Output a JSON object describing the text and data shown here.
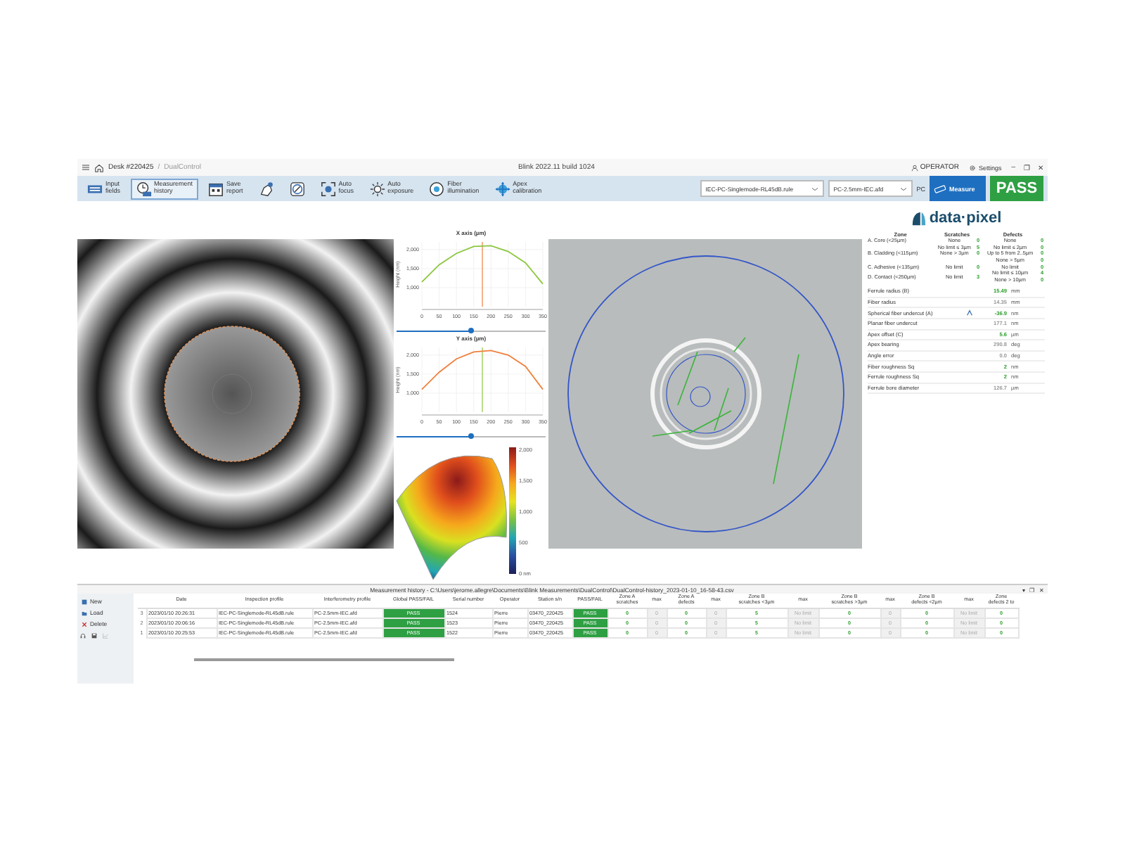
{
  "title_bar": {
    "breadcrumb": [
      "Desk #220425",
      "DualControl"
    ],
    "separator": "/",
    "app_title": "Blink 2022.11 build 1024",
    "user": "OPERATOR",
    "settings": "Settings",
    "window_controls": [
      "–",
      "❐",
      "✕"
    ]
  },
  "toolbar": {
    "buttons": [
      {
        "kind": "keyboard",
        "label": "Input\nfields",
        "selected": false
      },
      {
        "kind": "clock",
        "label": "Measurement\nhistory",
        "selected": true
      },
      {
        "kind": "calendar",
        "label": "Save\nreport",
        "selected": false
      },
      {
        "kind": "hand",
        "selected": false
      },
      {
        "kind": "compass",
        "selected": false
      },
      {
        "kind": "focus",
        "label": "Auto\nfocus",
        "selected": false
      },
      {
        "kind": "sun",
        "label": "Auto\nexposure",
        "selected": false
      },
      {
        "kind": "ring",
        "label": "Fiber\nillumination",
        "selected": false
      },
      {
        "kind": "crosshair",
        "label": "Apex\ncalibration",
        "selected": false
      }
    ],
    "profile_select": "IEC-PC-Singlemode-RL45dB.rule",
    "interferometry_select": "PC-2.5mm-IEC.afd",
    "connector_type": "PC",
    "measure_button": "Measure",
    "result": {
      "label": "PASS",
      "passed": true
    }
  },
  "profiles": [
    {
      "slider": {
        "level": 0.5
      },
      "chart_data": {
        "type": "line",
        "title": "X axis (µm)",
        "ylabel": "Height (nm)",
        "grid": true,
        "ref_lines": [
          {
            "axis": "x",
            "value": 175,
            "color": "#f07f3c"
          }
        ],
        "x": [
          0,
          50,
          100,
          150,
          200,
          250,
          300,
          350
        ],
        "series": [
          {
            "color": "#8cc63f",
            "values": [
              1150,
              1600,
              1900,
              2080,
              2100,
              1950,
              1650,
              1100
            ]
          }
        ],
        "xlim": [
          0,
          350
        ],
        "ylim": [
          500,
          2200
        ],
        "xticks": [
          0,
          50,
          100,
          150,
          200,
          250,
          300,
          350
        ],
        "yticks": [
          {
            "value": 1000,
            "label": "1,000"
          },
          {
            "value": 1500,
            "label": "1,500"
          },
          {
            "value": 2000,
            "label": "2,000"
          }
        ]
      }
    },
    {
      "slider": {
        "level": 0.5
      },
      "chart_data": {
        "type": "line",
        "title": "Y axis (µm)",
        "ylabel": "Height (nm)",
        "grid": true,
        "ref_lines": [
          {
            "axis": "x",
            "value": 175,
            "color": "#8cc63f"
          }
        ],
        "x": [
          0,
          50,
          100,
          150,
          200,
          250,
          300,
          350
        ],
        "series": [
          {
            "color": "#f07f3c",
            "values": [
              1100,
              1550,
              1900,
              2080,
              2120,
              2000,
              1700,
              1100
            ]
          }
        ],
        "xlim": [
          0,
          350
        ],
        "ylim": [
          500,
          2200
        ],
        "xticks": [
          0,
          50,
          100,
          150,
          200,
          250,
          300,
          350
        ],
        "yticks": [
          {
            "value": 1000,
            "label": "1,000"
          },
          {
            "value": 1500,
            "label": "1,500"
          },
          {
            "value": 2000,
            "label": "2,000"
          }
        ]
      }
    }
  ],
  "color_scale": [
    "2,000",
    "1,500",
    "1,000",
    "500",
    "0 nm"
  ],
  "results_panel": {
    "logo": "data·pixel",
    "headers": [
      "Zone",
      "Scratches",
      "Defects"
    ],
    "zones": [
      {
        "zone": "A. Core (<25µm)",
        "scratches": [
          {
            "limit": "None",
            "count": "0"
          }
        ],
        "defects": [
          {
            "limit": "None",
            "count": "0"
          }
        ]
      },
      {
        "zone": "B. Cladding (<115µm)",
        "scratches": [
          {
            "limit": "No limit ≤ 3µm",
            "count": "5"
          },
          {
            "limit": "None > 3µm",
            "count": "0"
          }
        ],
        "defects": [
          {
            "limit": "No limit ≤ 2µm",
            "count": "0"
          },
          {
            "limit": "Up to 5 from 2..5µm",
            "count": "0"
          },
          {
            "limit": "None > 5µm",
            "count": "0"
          }
        ]
      },
      {
        "zone": "C. Adhesive (<135µm)",
        "scratches": [
          {
            "limit": "No limit",
            "count": "0"
          }
        ],
        "defects": [
          {
            "limit": "No limit",
            "count": "0"
          }
        ]
      },
      {
        "zone": "D. Contact (<250µm)",
        "scratches": [
          {
            "limit": "No limit",
            "count": "3"
          }
        ],
        "defects": [
          {
            "limit": "No limit ≤ 10µm",
            "count": "4"
          },
          {
            "limit": "None > 10µm",
            "count": "0"
          }
        ]
      }
    ],
    "measurements": [
      {
        "label": "Ferrule radius (B)",
        "value": "15.49",
        "unit": "mm",
        "passed": true,
        "marked": false
      },
      {
        "label": "Fiber radius",
        "value": "14.35",
        "unit": "mm",
        "passed": false,
        "marked": false
      },
      {
        "label": "Spherical fiber undercut (A)",
        "value": "-36.9",
        "unit": "nm",
        "passed": true,
        "marked": true
      },
      {
        "label": "Planar fiber undercut",
        "value": "177.1",
        "unit": "nm",
        "passed": false,
        "marked": false
      },
      {
        "label": "Apex offset (C)",
        "value": "5.6",
        "unit": "µm",
        "passed": true,
        "marked": false
      },
      {
        "label": "Apex bearing",
        "value": "290.8",
        "unit": "deg",
        "passed": false,
        "marked": false
      },
      {
        "label": "Angle error",
        "value": "0.0",
        "unit": "deg",
        "passed": false,
        "marked": false
      },
      {
        "label": "Fiber roughness Sq",
        "value": "2",
        "unit": "nm",
        "passed": true,
        "marked": false
      },
      {
        "label": "Ferrule roughness Sq",
        "value": "2",
        "unit": "nm",
        "passed": true,
        "marked": false
      },
      {
        "label": "Ferrule bore diameter",
        "value": "126.7",
        "unit": "µm",
        "passed": false,
        "marked": false
      }
    ]
  },
  "history": {
    "title": "Measurement history - C:\\Users\\jerome.allegre\\Documents\\Blink Measurements\\DualControl\\DualControl-history_2023-01-10_16-58-43.csv",
    "panel_controls": [
      "▾",
      "❐",
      "✕"
    ],
    "actions": [
      "New",
      "Load",
      "Delete"
    ],
    "columns": [
      {
        "kind": "index"
      },
      {
        "label": "Date",
        "kind": "text"
      },
      {
        "label": "Inspection profile",
        "kind": "text"
      },
      {
        "label": "Interferometry profile",
        "kind": "text"
      },
      {
        "label": "Global PASS/FAIL",
        "kind": "pass"
      },
      {
        "label": "Serial number",
        "kind": "text"
      },
      {
        "label": "Operator",
        "kind": "text"
      },
      {
        "label": "Station s/n",
        "kind": "text"
      },
      {
        "label": "PASS/FAIL",
        "kind": "pass"
      },
      {
        "label": "Zone A\nscratches",
        "kind": "count"
      },
      {
        "label": "max",
        "kind": "max"
      },
      {
        "label": "Zone A\ndefects",
        "kind": "count"
      },
      {
        "label": "max",
        "kind": "max"
      },
      {
        "label": "Zone B\nscratches <3µm",
        "kind": "count"
      },
      {
        "label": "max",
        "kind": "max"
      },
      {
        "label": "Zone B\nscratches >3µm",
        "kind": "count"
      },
      {
        "label": "max",
        "kind": "max"
      },
      {
        "label": "Zone B\ndefects <2µm",
        "kind": "count"
      },
      {
        "label": "max",
        "kind": "max"
      },
      {
        "label": "Zone\ndefects 2 to",
        "kind": "count"
      }
    ],
    "rows": [
      [
        "3",
        "2023/01/10 20:26:31",
        "IEC-PC-Singlemode-RL45dB.rule",
        "PC-2.5mm-IEC.afd",
        "PASS",
        "1524",
        "Pierre",
        "03470_220425",
        "PASS",
        "0",
        "0",
        "0",
        "0",
        "5",
        "No limit",
        "0",
        "0",
        "0",
        "No limit",
        "0"
      ],
      [
        "2",
        "2023/01/10 20:06:16",
        "IEC-PC-Singlemode-RL45dB.rule",
        "PC-2.5mm-IEC.afd",
        "PASS",
        "1523",
        "Pierre",
        "03470_220425",
        "PASS",
        "0",
        "0",
        "0",
        "0",
        "5",
        "No limit",
        "0",
        "0",
        "0",
        "No limit",
        "0"
      ],
      [
        "1",
        "2023/01/10 20:25:53",
        "IEC-PC-Singlemode-RL45dB.rule",
        "PC-2.5mm-IEC.afd",
        "PASS",
        "1522",
        "Pierre",
        "03470_220425",
        "PASS",
        "0",
        "0",
        "0",
        "0",
        "5",
        "No limit",
        "0",
        "0",
        "0",
        "No limit",
        "0"
      ]
    ]
  }
}
